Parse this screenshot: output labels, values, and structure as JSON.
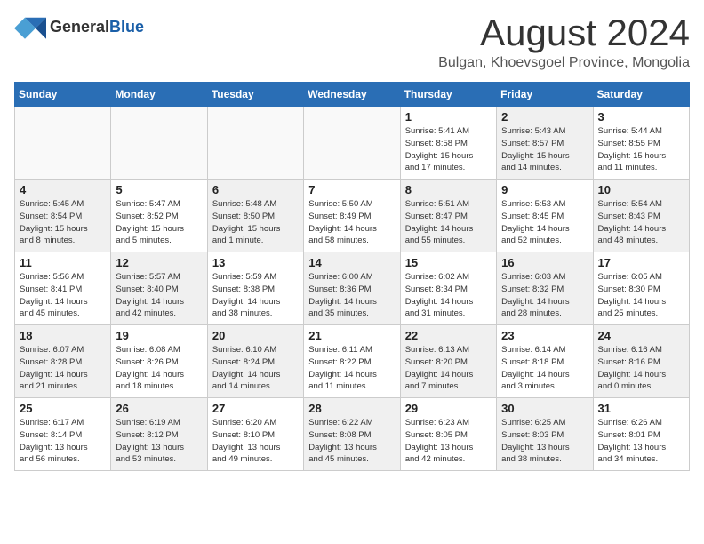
{
  "header": {
    "logo_general": "General",
    "logo_blue": "Blue",
    "month_year": "August 2024",
    "location": "Bulgan, Khoevsgoel Province, Mongolia"
  },
  "weekdays": [
    "Sunday",
    "Monday",
    "Tuesday",
    "Wednesday",
    "Thursday",
    "Friday",
    "Saturday"
  ],
  "weeks": [
    [
      {
        "day": "",
        "info": "",
        "shaded": false,
        "empty": true
      },
      {
        "day": "",
        "info": "",
        "shaded": false,
        "empty": true
      },
      {
        "day": "",
        "info": "",
        "shaded": false,
        "empty": true
      },
      {
        "day": "",
        "info": "",
        "shaded": false,
        "empty": true
      },
      {
        "day": "1",
        "info": "Sunrise: 5:41 AM\nSunset: 8:58 PM\nDaylight: 15 hours\nand 17 minutes.",
        "shaded": false,
        "empty": false
      },
      {
        "day": "2",
        "info": "Sunrise: 5:43 AM\nSunset: 8:57 PM\nDaylight: 15 hours\nand 14 minutes.",
        "shaded": true,
        "empty": false
      },
      {
        "day": "3",
        "info": "Sunrise: 5:44 AM\nSunset: 8:55 PM\nDaylight: 15 hours\nand 11 minutes.",
        "shaded": false,
        "empty": false
      }
    ],
    [
      {
        "day": "4",
        "info": "Sunrise: 5:45 AM\nSunset: 8:54 PM\nDaylight: 15 hours\nand 8 minutes.",
        "shaded": true,
        "empty": false
      },
      {
        "day": "5",
        "info": "Sunrise: 5:47 AM\nSunset: 8:52 PM\nDaylight: 15 hours\nand 5 minutes.",
        "shaded": false,
        "empty": false
      },
      {
        "day": "6",
        "info": "Sunrise: 5:48 AM\nSunset: 8:50 PM\nDaylight: 15 hours\nand 1 minute.",
        "shaded": true,
        "empty": false
      },
      {
        "day": "7",
        "info": "Sunrise: 5:50 AM\nSunset: 8:49 PM\nDaylight: 14 hours\nand 58 minutes.",
        "shaded": false,
        "empty": false
      },
      {
        "day": "8",
        "info": "Sunrise: 5:51 AM\nSunset: 8:47 PM\nDaylight: 14 hours\nand 55 minutes.",
        "shaded": true,
        "empty": false
      },
      {
        "day": "9",
        "info": "Sunrise: 5:53 AM\nSunset: 8:45 PM\nDaylight: 14 hours\nand 52 minutes.",
        "shaded": false,
        "empty": false
      },
      {
        "day": "10",
        "info": "Sunrise: 5:54 AM\nSunset: 8:43 PM\nDaylight: 14 hours\nand 48 minutes.",
        "shaded": true,
        "empty": false
      }
    ],
    [
      {
        "day": "11",
        "info": "Sunrise: 5:56 AM\nSunset: 8:41 PM\nDaylight: 14 hours\nand 45 minutes.",
        "shaded": false,
        "empty": false
      },
      {
        "day": "12",
        "info": "Sunrise: 5:57 AM\nSunset: 8:40 PM\nDaylight: 14 hours\nand 42 minutes.",
        "shaded": true,
        "empty": false
      },
      {
        "day": "13",
        "info": "Sunrise: 5:59 AM\nSunset: 8:38 PM\nDaylight: 14 hours\nand 38 minutes.",
        "shaded": false,
        "empty": false
      },
      {
        "day": "14",
        "info": "Sunrise: 6:00 AM\nSunset: 8:36 PM\nDaylight: 14 hours\nand 35 minutes.",
        "shaded": true,
        "empty": false
      },
      {
        "day": "15",
        "info": "Sunrise: 6:02 AM\nSunset: 8:34 PM\nDaylight: 14 hours\nand 31 minutes.",
        "shaded": false,
        "empty": false
      },
      {
        "day": "16",
        "info": "Sunrise: 6:03 AM\nSunset: 8:32 PM\nDaylight: 14 hours\nand 28 minutes.",
        "shaded": true,
        "empty": false
      },
      {
        "day": "17",
        "info": "Sunrise: 6:05 AM\nSunset: 8:30 PM\nDaylight: 14 hours\nand 25 minutes.",
        "shaded": false,
        "empty": false
      }
    ],
    [
      {
        "day": "18",
        "info": "Sunrise: 6:07 AM\nSunset: 8:28 PM\nDaylight: 14 hours\nand 21 minutes.",
        "shaded": true,
        "empty": false
      },
      {
        "day": "19",
        "info": "Sunrise: 6:08 AM\nSunset: 8:26 PM\nDaylight: 14 hours\nand 18 minutes.",
        "shaded": false,
        "empty": false
      },
      {
        "day": "20",
        "info": "Sunrise: 6:10 AM\nSunset: 8:24 PM\nDaylight: 14 hours\nand 14 minutes.",
        "shaded": true,
        "empty": false
      },
      {
        "day": "21",
        "info": "Sunrise: 6:11 AM\nSunset: 8:22 PM\nDaylight: 14 hours\nand 11 minutes.",
        "shaded": false,
        "empty": false
      },
      {
        "day": "22",
        "info": "Sunrise: 6:13 AM\nSunset: 8:20 PM\nDaylight: 14 hours\nand 7 minutes.",
        "shaded": true,
        "empty": false
      },
      {
        "day": "23",
        "info": "Sunrise: 6:14 AM\nSunset: 8:18 PM\nDaylight: 14 hours\nand 3 minutes.",
        "shaded": false,
        "empty": false
      },
      {
        "day": "24",
        "info": "Sunrise: 6:16 AM\nSunset: 8:16 PM\nDaylight: 14 hours\nand 0 minutes.",
        "shaded": true,
        "empty": false
      }
    ],
    [
      {
        "day": "25",
        "info": "Sunrise: 6:17 AM\nSunset: 8:14 PM\nDaylight: 13 hours\nand 56 minutes.",
        "shaded": false,
        "empty": false
      },
      {
        "day": "26",
        "info": "Sunrise: 6:19 AM\nSunset: 8:12 PM\nDaylight: 13 hours\nand 53 minutes.",
        "shaded": true,
        "empty": false
      },
      {
        "day": "27",
        "info": "Sunrise: 6:20 AM\nSunset: 8:10 PM\nDaylight: 13 hours\nand 49 minutes.",
        "shaded": false,
        "empty": false
      },
      {
        "day": "28",
        "info": "Sunrise: 6:22 AM\nSunset: 8:08 PM\nDaylight: 13 hours\nand 45 minutes.",
        "shaded": true,
        "empty": false
      },
      {
        "day": "29",
        "info": "Sunrise: 6:23 AM\nSunset: 8:05 PM\nDaylight: 13 hours\nand 42 minutes.",
        "shaded": false,
        "empty": false
      },
      {
        "day": "30",
        "info": "Sunrise: 6:25 AM\nSunset: 8:03 PM\nDaylight: 13 hours\nand 38 minutes.",
        "shaded": true,
        "empty": false
      },
      {
        "day": "31",
        "info": "Sunrise: 6:26 AM\nSunset: 8:01 PM\nDaylight: 13 hours\nand 34 minutes.",
        "shaded": false,
        "empty": false
      }
    ]
  ]
}
